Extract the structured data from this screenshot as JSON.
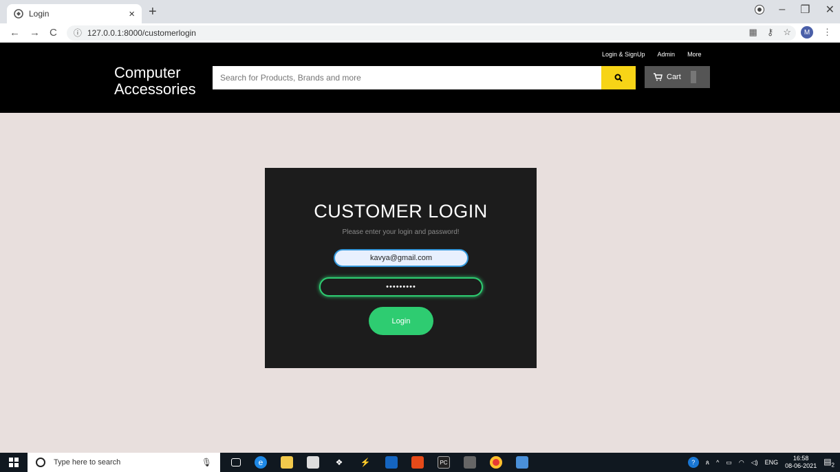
{
  "browser": {
    "tab_title": "Login",
    "tab_close": "×",
    "new_tab": "+",
    "url": "127.0.0.1:8000/customerlogin",
    "nav": {
      "back": "←",
      "forward": "→",
      "reload": "C"
    },
    "window": {
      "minimize": "–",
      "restore": "❐",
      "close": "✕"
    },
    "profile_initial": "M"
  },
  "header": {
    "brand_line1": "Computer",
    "brand_line2": "Accessories",
    "top_links": [
      "Login & SignUp",
      "Admin",
      "More"
    ],
    "search_placeholder": "Search for Products, Brands and more",
    "cart_label": "Cart"
  },
  "login": {
    "title": "CUSTOMER LOGIN",
    "subtitle": "Please enter your login and password!",
    "email_value": "kavya@gmail.com",
    "password_value": "•••••••••",
    "button_label": "Login"
  },
  "taskbar": {
    "search_placeholder": "Type here to search",
    "language": "ENG",
    "time": "16:58",
    "date": "08-06-2021",
    "notification_count": "2"
  },
  "colors": {
    "page_bg": "#e8dfdd",
    "header_bg": "#000000",
    "search_btn": "#f7d417",
    "cart_btn": "#555555",
    "card_bg": "#1c1c1c",
    "email_border": "#3498db",
    "accent_green": "#2ecc71"
  }
}
